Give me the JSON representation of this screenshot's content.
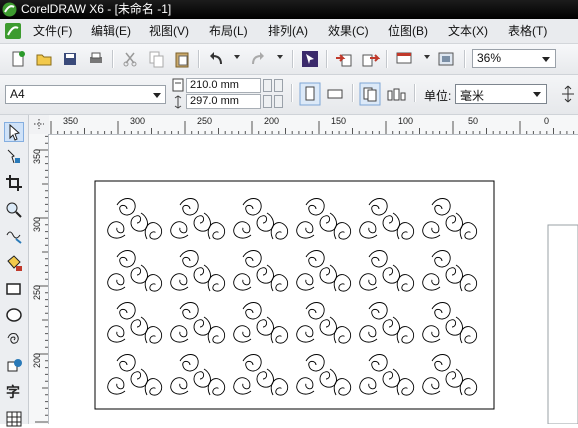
{
  "window": {
    "title": "CorelDRAW X6 - [未命名 -1]"
  },
  "menu": {
    "items": [
      {
        "label": "文件(F)"
      },
      {
        "label": "编辑(E)"
      },
      {
        "label": "视图(V)"
      },
      {
        "label": "布局(L)"
      },
      {
        "label": "排列(A)"
      },
      {
        "label": "效果(C)"
      },
      {
        "label": "位图(B)"
      },
      {
        "label": "文本(X)"
      },
      {
        "label": "表格(T)"
      }
    ]
  },
  "toolbar": {
    "icons": [
      "new-icon",
      "open-icon",
      "save-icon",
      "print-icon",
      "cut-icon",
      "copy-icon",
      "paste-icon",
      "undo-icon",
      "redo-icon",
      "search-content-icon",
      "import-icon",
      "export-icon",
      "application-launcher-icon",
      "welcome-screen-icon"
    ],
    "zoom_value": "36%"
  },
  "property_bar": {
    "page_size": "A4",
    "width": "210.0 mm",
    "height": "297.0 mm",
    "unit_label": "单位:",
    "unit_value": "毫米"
  },
  "rulers": {
    "top_labels": [
      "350",
      "300",
      "250",
      "200",
      "150",
      "100",
      "50",
      "0"
    ],
    "left_labels": [
      "350",
      "300",
      "250",
      "200"
    ]
  },
  "toolbox": {
    "tools": [
      "pick-tool",
      "shape-tool",
      "crop-tool",
      "zoom-tool",
      "freehand-tool",
      "smart-fill-tool",
      "rectangle-tool",
      "ellipse-tool",
      "spiral-tool",
      "basic-shapes-tool",
      "text-tool",
      "table-tool"
    ],
    "text_tool_glyph": "字"
  },
  "colors": {
    "title_bar": "#000000",
    "menu_bar": "#e9ebee",
    "canvas": "#ffffff",
    "stroke": "#000000",
    "active_tool": "#cfe2f8"
  }
}
